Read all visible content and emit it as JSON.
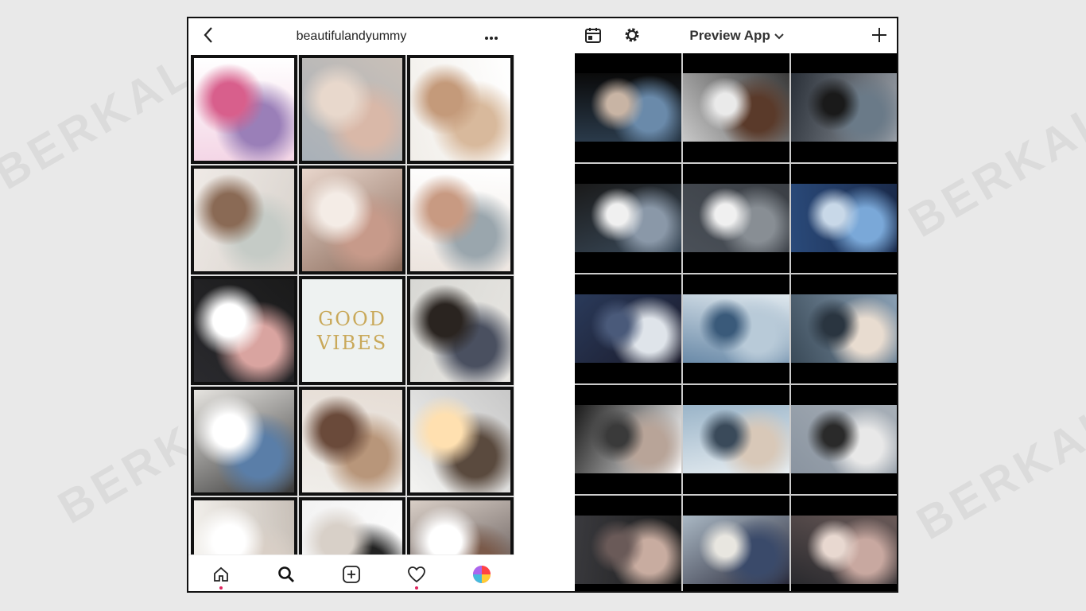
{
  "watermark": "BERKAL",
  "left_app": {
    "username": "beautifulandyummy",
    "back_icon": "chevron-left-icon",
    "more_icon": "ellipsis-icon",
    "grid": [
      {
        "kind": "photo",
        "subject": "flower-stall",
        "colors": [
          "#f4d6e6",
          "#9a7fb8",
          "#d85f8c",
          "#ffffff"
        ]
      },
      {
        "kind": "photo",
        "subject": "sequin-gown",
        "colors": [
          "#a8b0b8",
          "#d9b8a8",
          "#e8d8cc",
          "#c9c0b8"
        ]
      },
      {
        "kind": "photo",
        "subject": "makeup-brushes",
        "colors": [
          "#f1eee9",
          "#d8b99c",
          "#c49a7a",
          "#ffffff"
        ]
      },
      {
        "kind": "photo",
        "subject": "grey-sweater",
        "colors": [
          "#efeae6",
          "#c5cbc6",
          "#8a6a55",
          "#d8d2cc"
        ]
      },
      {
        "kind": "photo",
        "subject": "coffee-blanket",
        "colors": [
          "#e8d6cc",
          "#c79a8a",
          "#f4ece6",
          "#8a6a5a"
        ]
      },
      {
        "kind": "photo",
        "subject": "flatlay-items",
        "colors": [
          "#ece4de",
          "#9aa6ad",
          "#c89a82",
          "#ffffff"
        ]
      },
      {
        "kind": "photo",
        "subject": "pink-cardigan",
        "colors": [
          "#2a2a2e",
          "#d9a4a0",
          "#ffffff",
          "#1a1a1a"
        ]
      },
      {
        "kind": "text",
        "line1": "GOOD",
        "line2": "VIBES",
        "colors": [
          "#eef2f1",
          "#c9a95a"
        ]
      },
      {
        "kind": "photo",
        "subject": "girl-sitting",
        "colors": [
          "#d8d8d4",
          "#4a5060",
          "#2a2420",
          "#e8e6e2"
        ]
      },
      {
        "kind": "photo",
        "subject": "white-sneakers",
        "colors": [
          "#e6e4e0",
          "#5a7ea8",
          "#ffffff",
          "#3a3a3a"
        ]
      },
      {
        "kind": "photo",
        "subject": "leather-jacket",
        "colors": [
          "#f0eeea",
          "#b8967a",
          "#6a4a3a",
          "#e6ddd5"
        ]
      },
      {
        "kind": "photo",
        "subject": "cartoon-bag",
        "colors": [
          "#f4f4f2",
          "#5a4a3e",
          "#ffe0b0",
          "#c8c8c8"
        ]
      },
      {
        "kind": "photo",
        "subject": "white-top",
        "colors": [
          "#f4f2ee",
          "#d9cfc6",
          "#ffffff",
          "#c8c0b8"
        ]
      },
      {
        "kind": "photo",
        "subject": "shoes-flatlay",
        "colors": [
          "#f2f2f2",
          "#222222",
          "#d8d0c8",
          "#ffffff"
        ]
      },
      {
        "kind": "photo",
        "subject": "street-outfit",
        "colors": [
          "#d8cec6",
          "#7a5a4a",
          "#ffffff",
          "#4a4040"
        ]
      }
    ],
    "tabbar": [
      {
        "name": "home-icon",
        "dot": true
      },
      {
        "name": "search-icon",
        "dot": false
      },
      {
        "name": "add-post-icon",
        "dot": false
      },
      {
        "name": "heart-icon",
        "dot": true
      },
      {
        "name": "profile-avatar-icon",
        "dot": false
      }
    ]
  },
  "right_app": {
    "title": "Preview App",
    "title_caret": "chevron-down-icon",
    "calendar_icon": "calendar-icon",
    "settings_icon": "gear-icon",
    "add_icon": "plus-icon",
    "grid": [
      {
        "subject": "selfie-phone",
        "colors": [
          "#2a3a4a",
          "#6a8aaa",
          "#c8b4a4",
          "#0a0a0a"
        ]
      },
      {
        "subject": "laptop-coffee",
        "colors": [
          "#c8c8c8",
          "#5a3a2a",
          "#eaeaea",
          "#3a3a3a"
        ]
      },
      {
        "subject": "dark-laptop-keys",
        "colors": [
          "#2a3038",
          "#6a7a88",
          "#1a1a1a",
          "#9aa0a8"
        ]
      },
      {
        "subject": "sneakers-denim",
        "colors": [
          "#1a1a1a",
          "#8a98a8",
          "#f0f0f0",
          "#3a4a5a"
        ]
      },
      {
        "subject": "asphalt-lines",
        "colors": [
          "#4a5058",
          "#888e94",
          "#f0f0f0",
          "#3a3e44"
        ]
      },
      {
        "subject": "blue-hair",
        "colors": [
          "#2a4a7a",
          "#7aa8d8",
          "#c8d8e8",
          "#1a2a4a"
        ]
      },
      {
        "subject": "polaroid-wall",
        "colors": [
          "#2a3a5a",
          "#dfe4ea",
          "#4a5a7a",
          "#1a1a2a"
        ]
      },
      {
        "subject": "heart-in-frost",
        "colors": [
          "#6a8aa8",
          "#b8cad8",
          "#3a5a7a",
          "#dfe8ee"
        ]
      },
      {
        "subject": "coffee-hand",
        "colors": [
          "#3a4a58",
          "#e8dcd0",
          "#2a3540",
          "#8aa0b4"
        ]
      },
      {
        "subject": "black-tee-nike",
        "colors": [
          "#1a1a1a",
          "#b8a498",
          "#3a3a3a",
          "#ffffff"
        ]
      },
      {
        "subject": "couple-beach",
        "colors": [
          "#9ab4c8",
          "#d8c8b8",
          "#3a4a5a",
          "#e8eef2"
        ]
      },
      {
        "subject": "vip-street",
        "colors": [
          "#8a94a0",
          "#e8e8e8",
          "#2a2a2a",
          "#a8b0b8"
        ]
      },
      {
        "subject": "hand-doodles",
        "colors": [
          "#3a3a3e",
          "#c8aca0",
          "#6a5a58",
          "#1a1a1a"
        ]
      },
      {
        "subject": "braided-hair",
        "colors": [
          "#aab8c4",
          "#3a4a6a",
          "#e8e6e0",
          "#2a2a3a"
        ]
      },
      {
        "subject": "ice-cream-cone",
        "colors": [
          "#2a2a2e",
          "#c8a8a0",
          "#e8d8d0",
          "#6a5a58"
        ]
      }
    ]
  }
}
